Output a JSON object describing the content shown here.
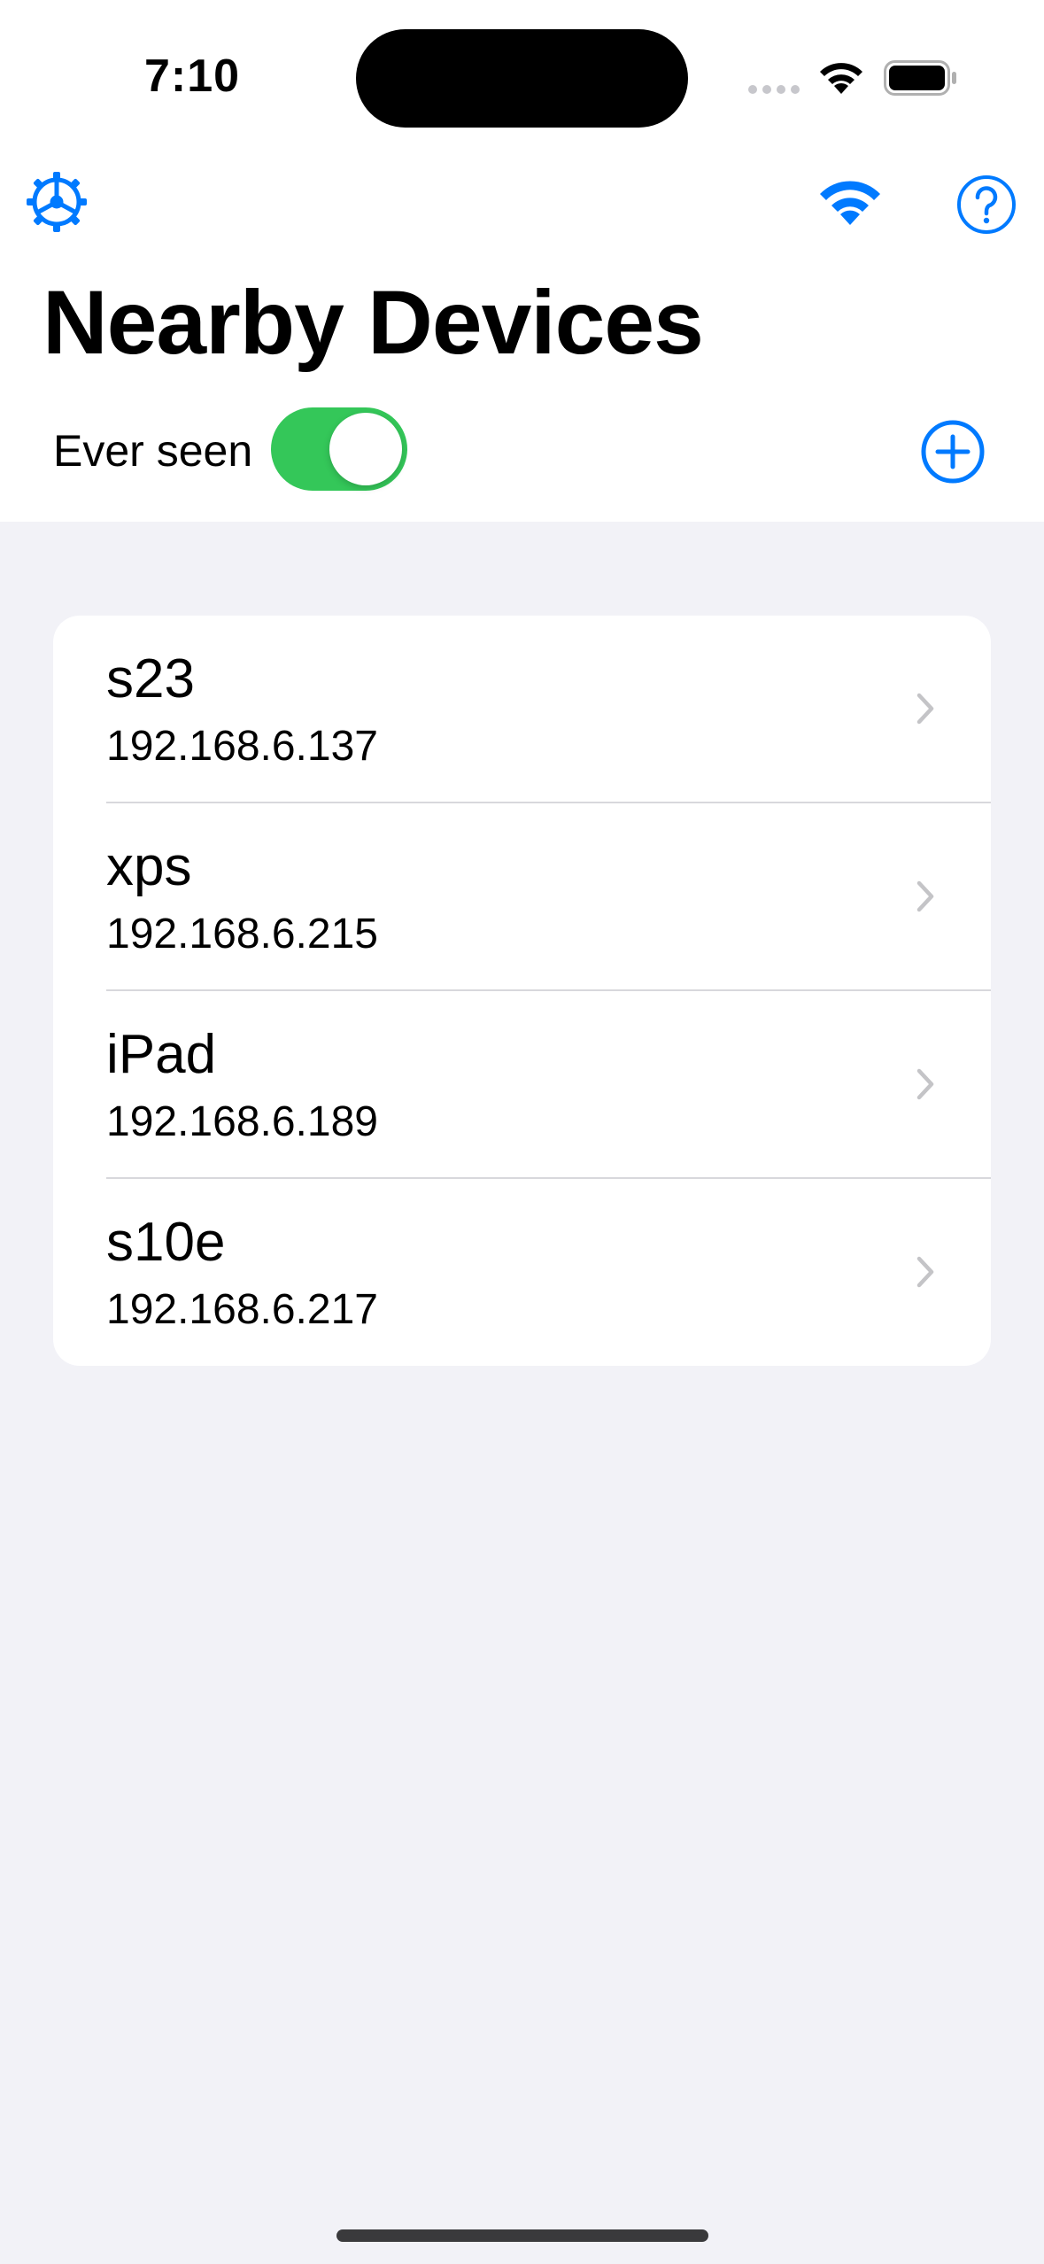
{
  "status_bar": {
    "time": "7:10"
  },
  "toolbar": {
    "settings_icon": "steering-wheel-gear-icon",
    "wifi_icon": "wifi-icon",
    "help_icon": "question-circle-icon"
  },
  "page": {
    "title": "Nearby Devices"
  },
  "filter": {
    "ever_seen_label": "Ever seen",
    "ever_seen_on": true,
    "add_icon": "plus-circle-icon"
  },
  "devices": [
    {
      "name": "s23",
      "ip": "192.168.6.137"
    },
    {
      "name": "xps",
      "ip": "192.168.6.215"
    },
    {
      "name": "iPad",
      "ip": "192.168.6.189"
    },
    {
      "name": "s10e",
      "ip": "192.168.6.217"
    }
  ],
  "colors": {
    "accent": "#007aff",
    "toggle_on": "#34c759",
    "background": "#f2f2f7",
    "chevron": "#c4c4c7"
  }
}
